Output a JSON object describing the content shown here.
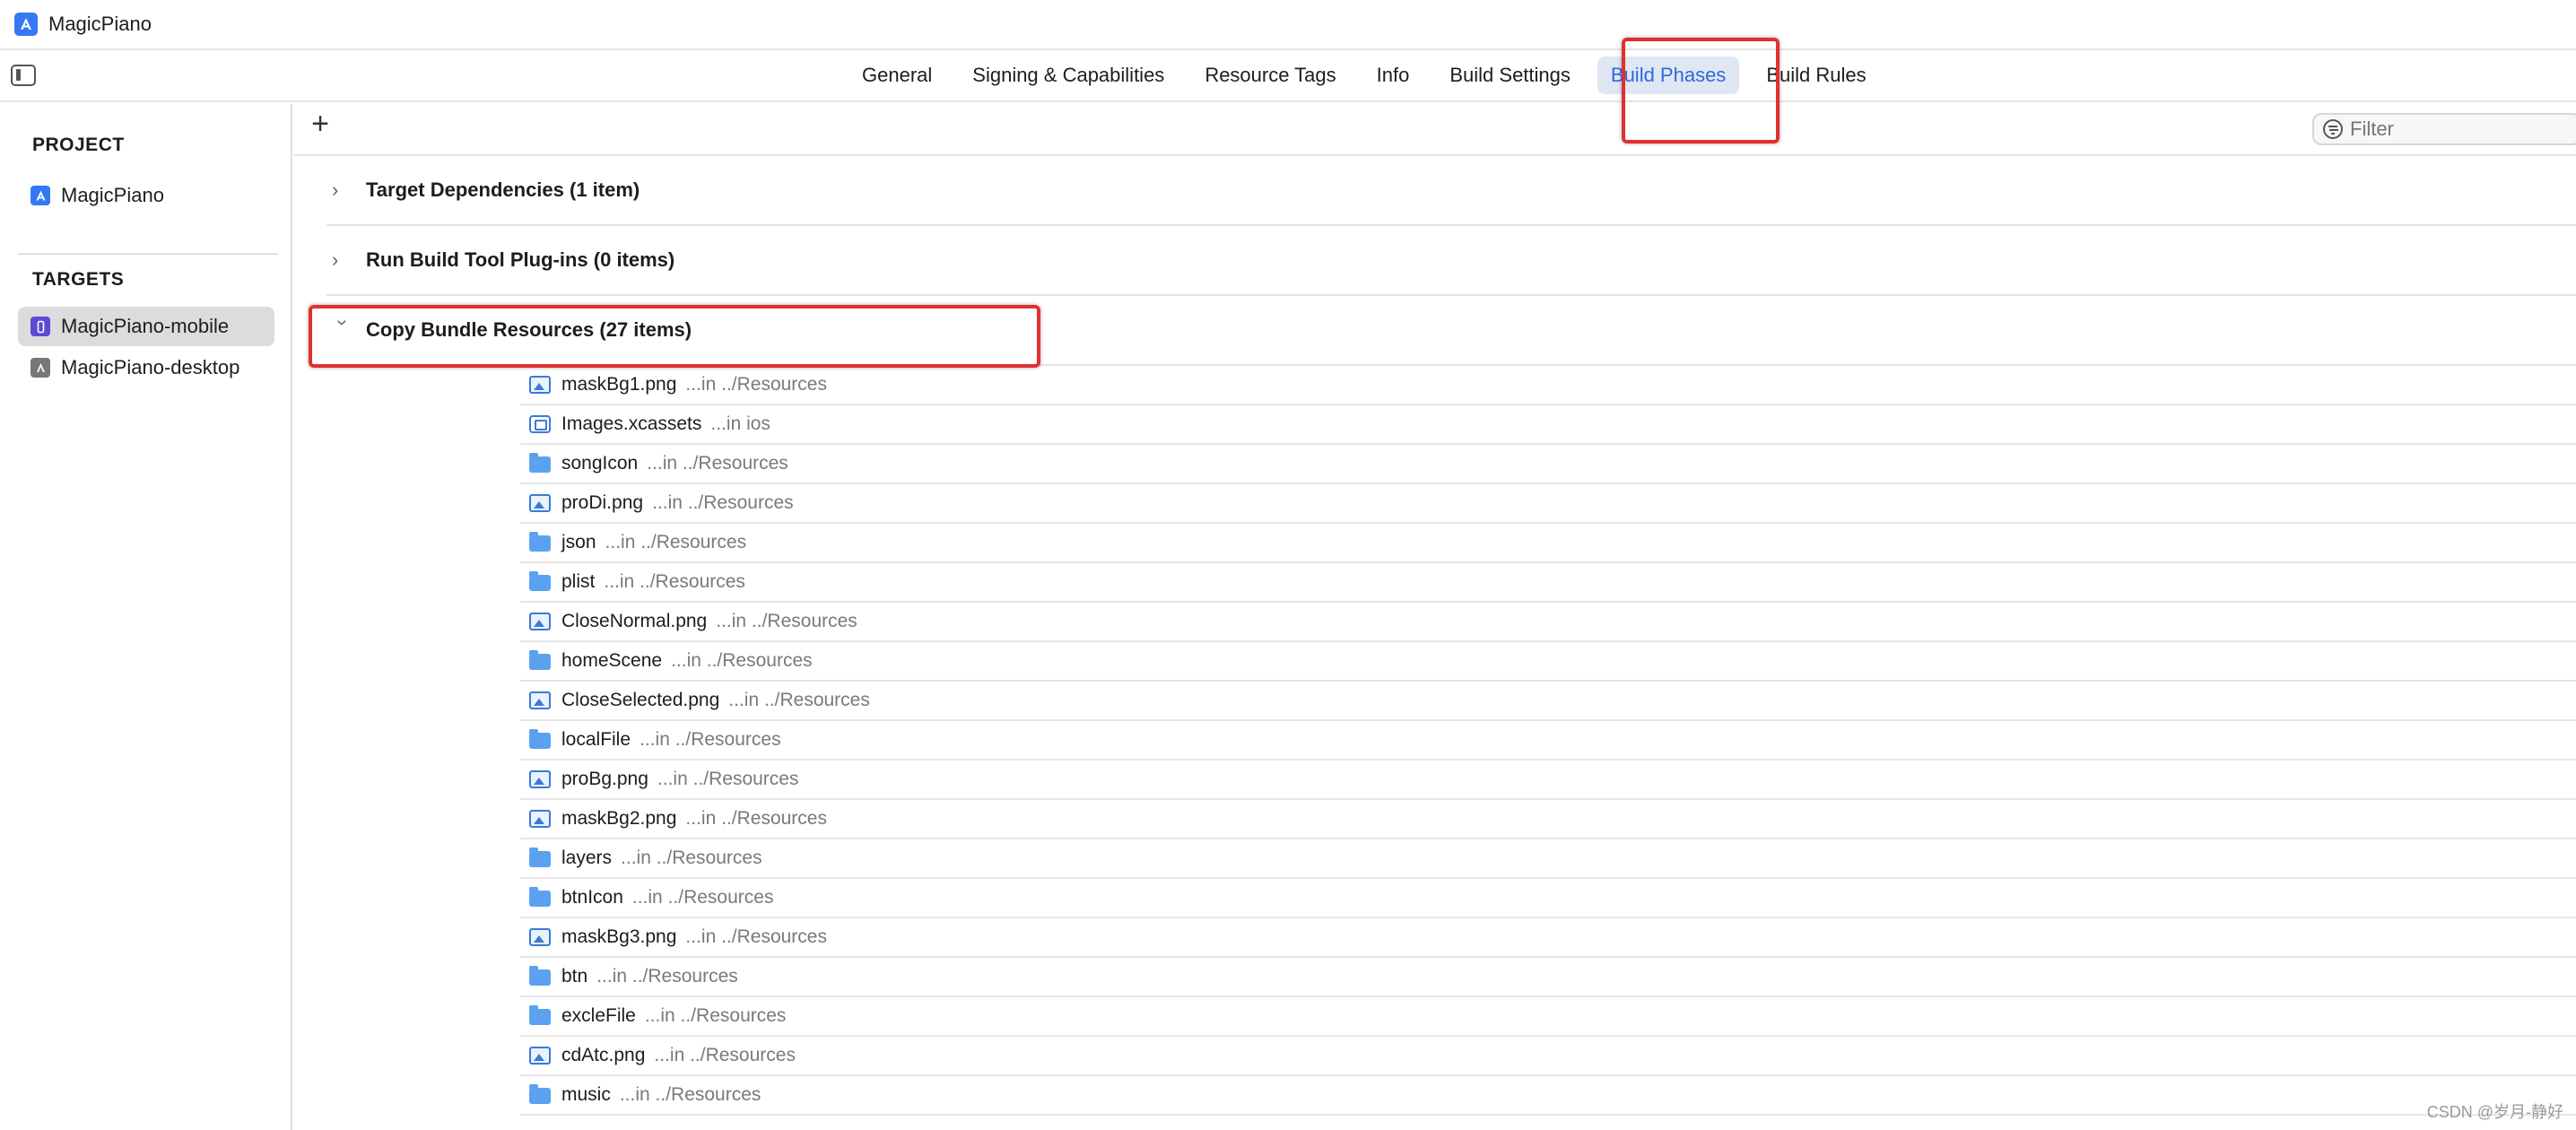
{
  "window": {
    "title": "MagicPiano"
  },
  "tabs": [
    {
      "label": "General"
    },
    {
      "label": "Signing & Capabilities"
    },
    {
      "label": "Resource Tags"
    },
    {
      "label": "Info"
    },
    {
      "label": "Build Settings"
    },
    {
      "label": "Build Phases",
      "active": true
    },
    {
      "label": "Build Rules"
    }
  ],
  "sidebar": {
    "project_header": "PROJECT",
    "project_item": "MagicPiano",
    "targets_header": "TARGETS",
    "targets": [
      {
        "label": "MagicPiano-mobile",
        "selected": true
      },
      {
        "label": "MagicPiano-desktop"
      }
    ]
  },
  "toolbar": {
    "add_label": "+",
    "filter_placeholder": "Filter"
  },
  "phases": [
    {
      "title": "Target Dependencies (1 item)",
      "expanded": false
    },
    {
      "title": "Run Build Tool Plug-ins (0 items)",
      "expanded": false
    },
    {
      "title": "Copy Bundle Resources (27 items)",
      "expanded": true
    }
  ],
  "files": [
    {
      "name": "maskBg1.png",
      "path": "...in ../Resources",
      "icon": "image-file-icon"
    },
    {
      "name": "Images.xcassets",
      "path": "...in ios",
      "icon": "asset-catalog-icon"
    },
    {
      "name": "songIcon",
      "path": "...in ../Resources",
      "icon": "folder-icon"
    },
    {
      "name": "proDi.png",
      "path": "...in ../Resources",
      "icon": "image-file-icon"
    },
    {
      "name": "json",
      "path": "...in ../Resources",
      "icon": "folder-icon"
    },
    {
      "name": "plist",
      "path": "...in ../Resources",
      "icon": "folder-icon"
    },
    {
      "name": "CloseNormal.png",
      "path": "...in ../Resources",
      "icon": "image-file-icon"
    },
    {
      "name": "homeScene",
      "path": "...in ../Resources",
      "icon": "folder-icon"
    },
    {
      "name": "CloseSelected.png",
      "path": "...in ../Resources",
      "icon": "image-file-icon"
    },
    {
      "name": "localFile",
      "path": "...in ../Resources",
      "icon": "folder-icon"
    },
    {
      "name": "proBg.png",
      "path": "...in ../Resources",
      "icon": "image-file-icon"
    },
    {
      "name": "maskBg2.png",
      "path": "...in ../Resources",
      "icon": "image-file-icon"
    },
    {
      "name": "layers",
      "path": "...in ../Resources",
      "icon": "folder-icon"
    },
    {
      "name": "btnIcon",
      "path": "...in ../Resources",
      "icon": "folder-icon"
    },
    {
      "name": "maskBg3.png",
      "path": "...in ../Resources",
      "icon": "image-file-icon"
    },
    {
      "name": "btn",
      "path": "...in ../Resources",
      "icon": "folder-icon"
    },
    {
      "name": "excleFile",
      "path": "...in ../Resources",
      "icon": "folder-icon"
    },
    {
      "name": "cdAtc.png",
      "path": "...in ../Resources",
      "icon": "image-file-icon"
    },
    {
      "name": "music",
      "path": "...in ../Resources",
      "icon": "folder-icon"
    }
  ],
  "watermark": "CSDN @岁月-静好",
  "colors": {
    "accent": "#2e6ad8",
    "annotation": "#e03030",
    "folder": "#5aa2ef"
  }
}
